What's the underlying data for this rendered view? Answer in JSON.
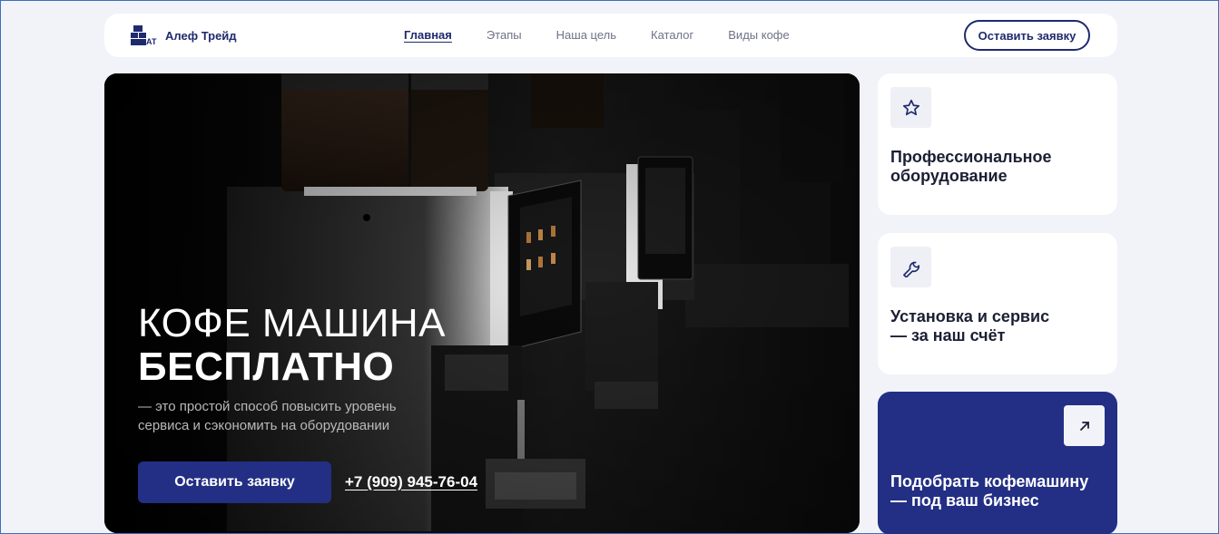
{
  "header": {
    "brand": "Алеф Трейд",
    "logo_mark": "АТ",
    "nav": [
      {
        "label": "Главная",
        "active": true
      },
      {
        "label": "Этапы",
        "active": false
      },
      {
        "label": "Наша цель",
        "active": false
      },
      {
        "label": "Каталог",
        "active": false
      },
      {
        "label": "Виды кофе",
        "active": false
      }
    ],
    "cta_label": "Оставить заявку"
  },
  "hero": {
    "title_line1": "КОФЕ МАШИНА",
    "title_line2": "БЕСПЛАТНО",
    "subtitle": "— это простой способ повысить уровень сервиса и сэкономить на оборудовании",
    "button_label": "Оставить заявку",
    "phone": "+7 (909) 945-76-04"
  },
  "cards": [
    {
      "title": "Профессиональное\nоборудование",
      "icon": "star-icon"
    },
    {
      "title": "Установка и сервис\n— за наш счёт",
      "icon": "wrench-icon"
    },
    {
      "title": "Подобрать кофемашину\n— под ваш бизнес",
      "icon": "arrow-up-right-icon"
    }
  ],
  "colors": {
    "brand": "#1f2a6e",
    "accent": "#232f84",
    "page_bg": "#f1f3f8",
    "hero_bg": "#050505"
  }
}
